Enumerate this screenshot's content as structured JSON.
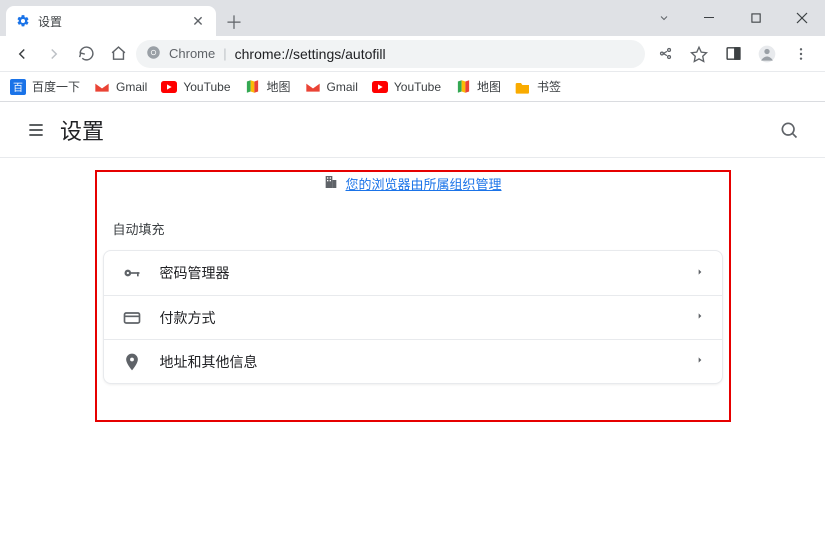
{
  "tab": {
    "title": "设置"
  },
  "url": {
    "prefix": "Chrome",
    "path": "chrome://settings/autofill"
  },
  "bookmarks": [
    {
      "label": "百度一下",
      "icon": "baidu"
    },
    {
      "label": "Gmail",
      "icon": "gmail"
    },
    {
      "label": "YouTube",
      "icon": "youtube"
    },
    {
      "label": "地图",
      "icon": "maps"
    },
    {
      "label": "Gmail",
      "icon": "gmail"
    },
    {
      "label": "YouTube",
      "icon": "youtube"
    },
    {
      "label": "地图",
      "icon": "maps"
    },
    {
      "label": "书签",
      "icon": "folder"
    }
  ],
  "app": {
    "title": "设置"
  },
  "managed_notice": "您的浏览器由所属组织管理",
  "section": {
    "title": "自动填充",
    "rows": [
      {
        "icon": "key",
        "label": "密码管理器"
      },
      {
        "icon": "card",
        "label": "付款方式"
      },
      {
        "icon": "location",
        "label": "地址和其他信息"
      }
    ]
  }
}
